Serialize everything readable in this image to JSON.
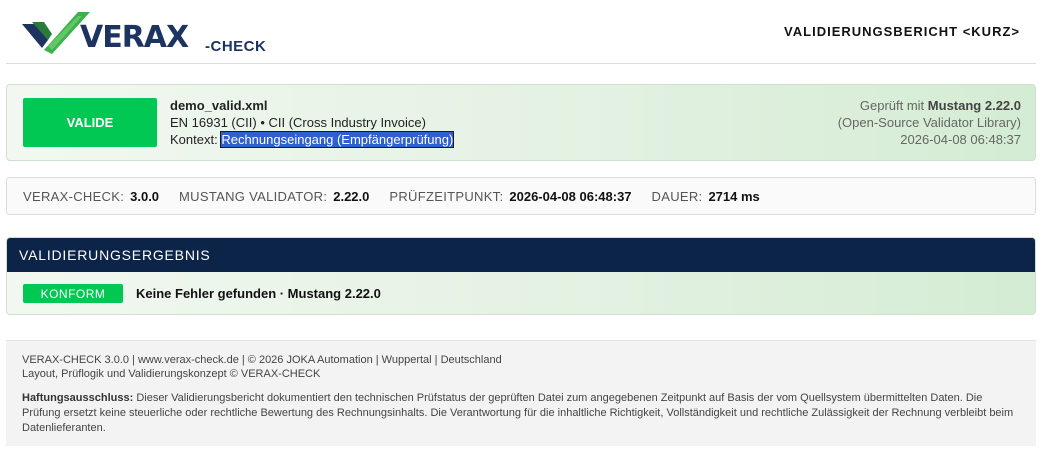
{
  "header": {
    "logo_text": "VERAX",
    "logo_sub": "-CHECK",
    "report_title": "VALIDIERUNGSBERICHT <KURZ>"
  },
  "colors": {
    "brand_navy": "#1d3461",
    "brand_green": "#3cb34a",
    "valid_green": "#00c853",
    "result_header": "#0b2447",
    "selection_blue": "#2f5fd0"
  },
  "status_card": {
    "badge_label": "VALIDE",
    "file_name": "demo_valid.xml",
    "standard": "EN 16931 (CII) • CII (Cross Industry Invoice)",
    "context_label": "Kontext:",
    "context_value": "Rechnungseingang (Empfängerprüfung)",
    "checked_with_prefix": "Geprüft mit",
    "checked_with_value": "Mustang 2.22.0",
    "library_note": "(Open-Source Validator Library)",
    "timestamp": "2026-04-08 06:48:37"
  },
  "meta": {
    "items": [
      {
        "label": "VERAX-CHECK:",
        "value": "3.0.0"
      },
      {
        "label": "MUSTANG VALIDATOR:",
        "value": "2.22.0"
      },
      {
        "label": "PRÜFZEITPUNKT:",
        "value": "2026-04-08 06:48:37"
      },
      {
        "label": "DAUER:",
        "value": "2714 ms"
      }
    ]
  },
  "result": {
    "header_title": "VALIDIERUNGSERGEBNIS",
    "badge_label": "KONFORM",
    "summary": "Keine Fehler gefunden · Mustang 2.22.0"
  },
  "footer": {
    "line1": "VERAX-CHECK 3.0.0 | www.verax-check.de | © 2026 JOKA Automation | Wuppertal | Deutschland",
    "line2": "Layout, Prüflogik und Validierungskonzept © VERAX-CHECK",
    "disclaimer_label": "Haftungsausschluss:",
    "disclaimer_text": "Dieser Validierungsbericht dokumentiert den technischen Prüfstatus der geprüften Datei zum angegebenen Zeitpunkt auf Basis der vom Quellsystem übermittelten Daten. Die Prüfung ersetzt keine steuerliche oder rechtliche Bewertung des Rechnungsinhalts. Die Verantwortung für die inhaltliche Richtigkeit, Vollständigkeit und rechtliche Zulässigkeit der Rechnung verbleibt beim Datenlieferanten."
  }
}
